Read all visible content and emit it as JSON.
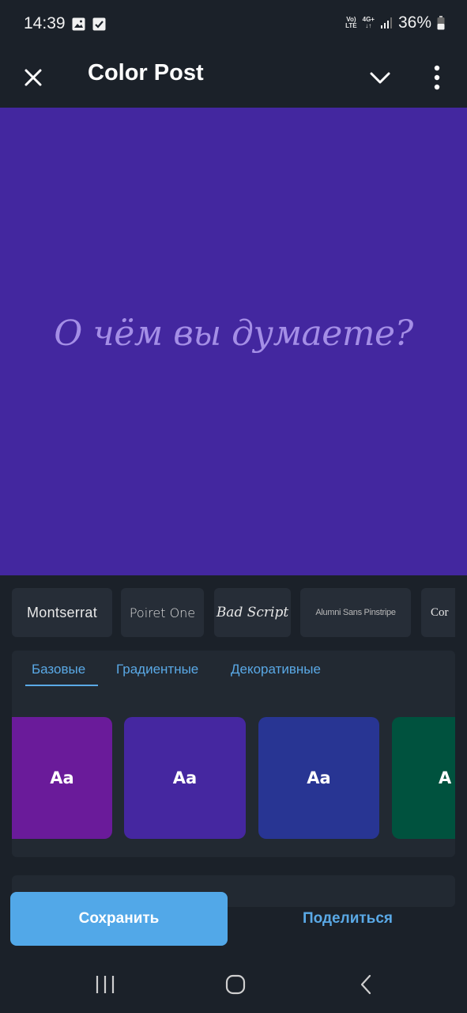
{
  "status_bar": {
    "time": "14:39",
    "network_small_1a": "Vo)",
    "network_small_1b": "LTE",
    "network_small_2": "4G+",
    "battery_percent": "36%"
  },
  "toolbar": {
    "title": "Color Post",
    "close_icon": "close-icon",
    "expand_icon": "chevron-down-icon",
    "more_icon": "more-vertical-icon"
  },
  "canvas": {
    "placeholder_text": "О чём вы думаете?",
    "background_color": "#43279f",
    "text_color": "#a48ee6"
  },
  "fonts": [
    {
      "label": "Montserrat"
    },
    {
      "label": "Poiret One"
    },
    {
      "label": "Bad Script"
    },
    {
      "label": "Alumni Sans Pinstripe"
    },
    {
      "label": "Cor"
    }
  ],
  "style_tabs": [
    {
      "label": "Базовые",
      "selected": true
    },
    {
      "label": "Градиентные",
      "selected": false
    },
    {
      "label": "Декоративные",
      "selected": false
    }
  ],
  "swatches": [
    {
      "label": "Aa",
      "color": "#6a1b9a"
    },
    {
      "label": "Aa",
      "color": "#4527a0"
    },
    {
      "label": "Aa",
      "color": "#283593"
    },
    {
      "label": "A",
      "color": "#00523e"
    }
  ],
  "actions": {
    "save_label": "Сохранить",
    "share_label": "Поделиться"
  },
  "accent_color": "#52a8e8"
}
